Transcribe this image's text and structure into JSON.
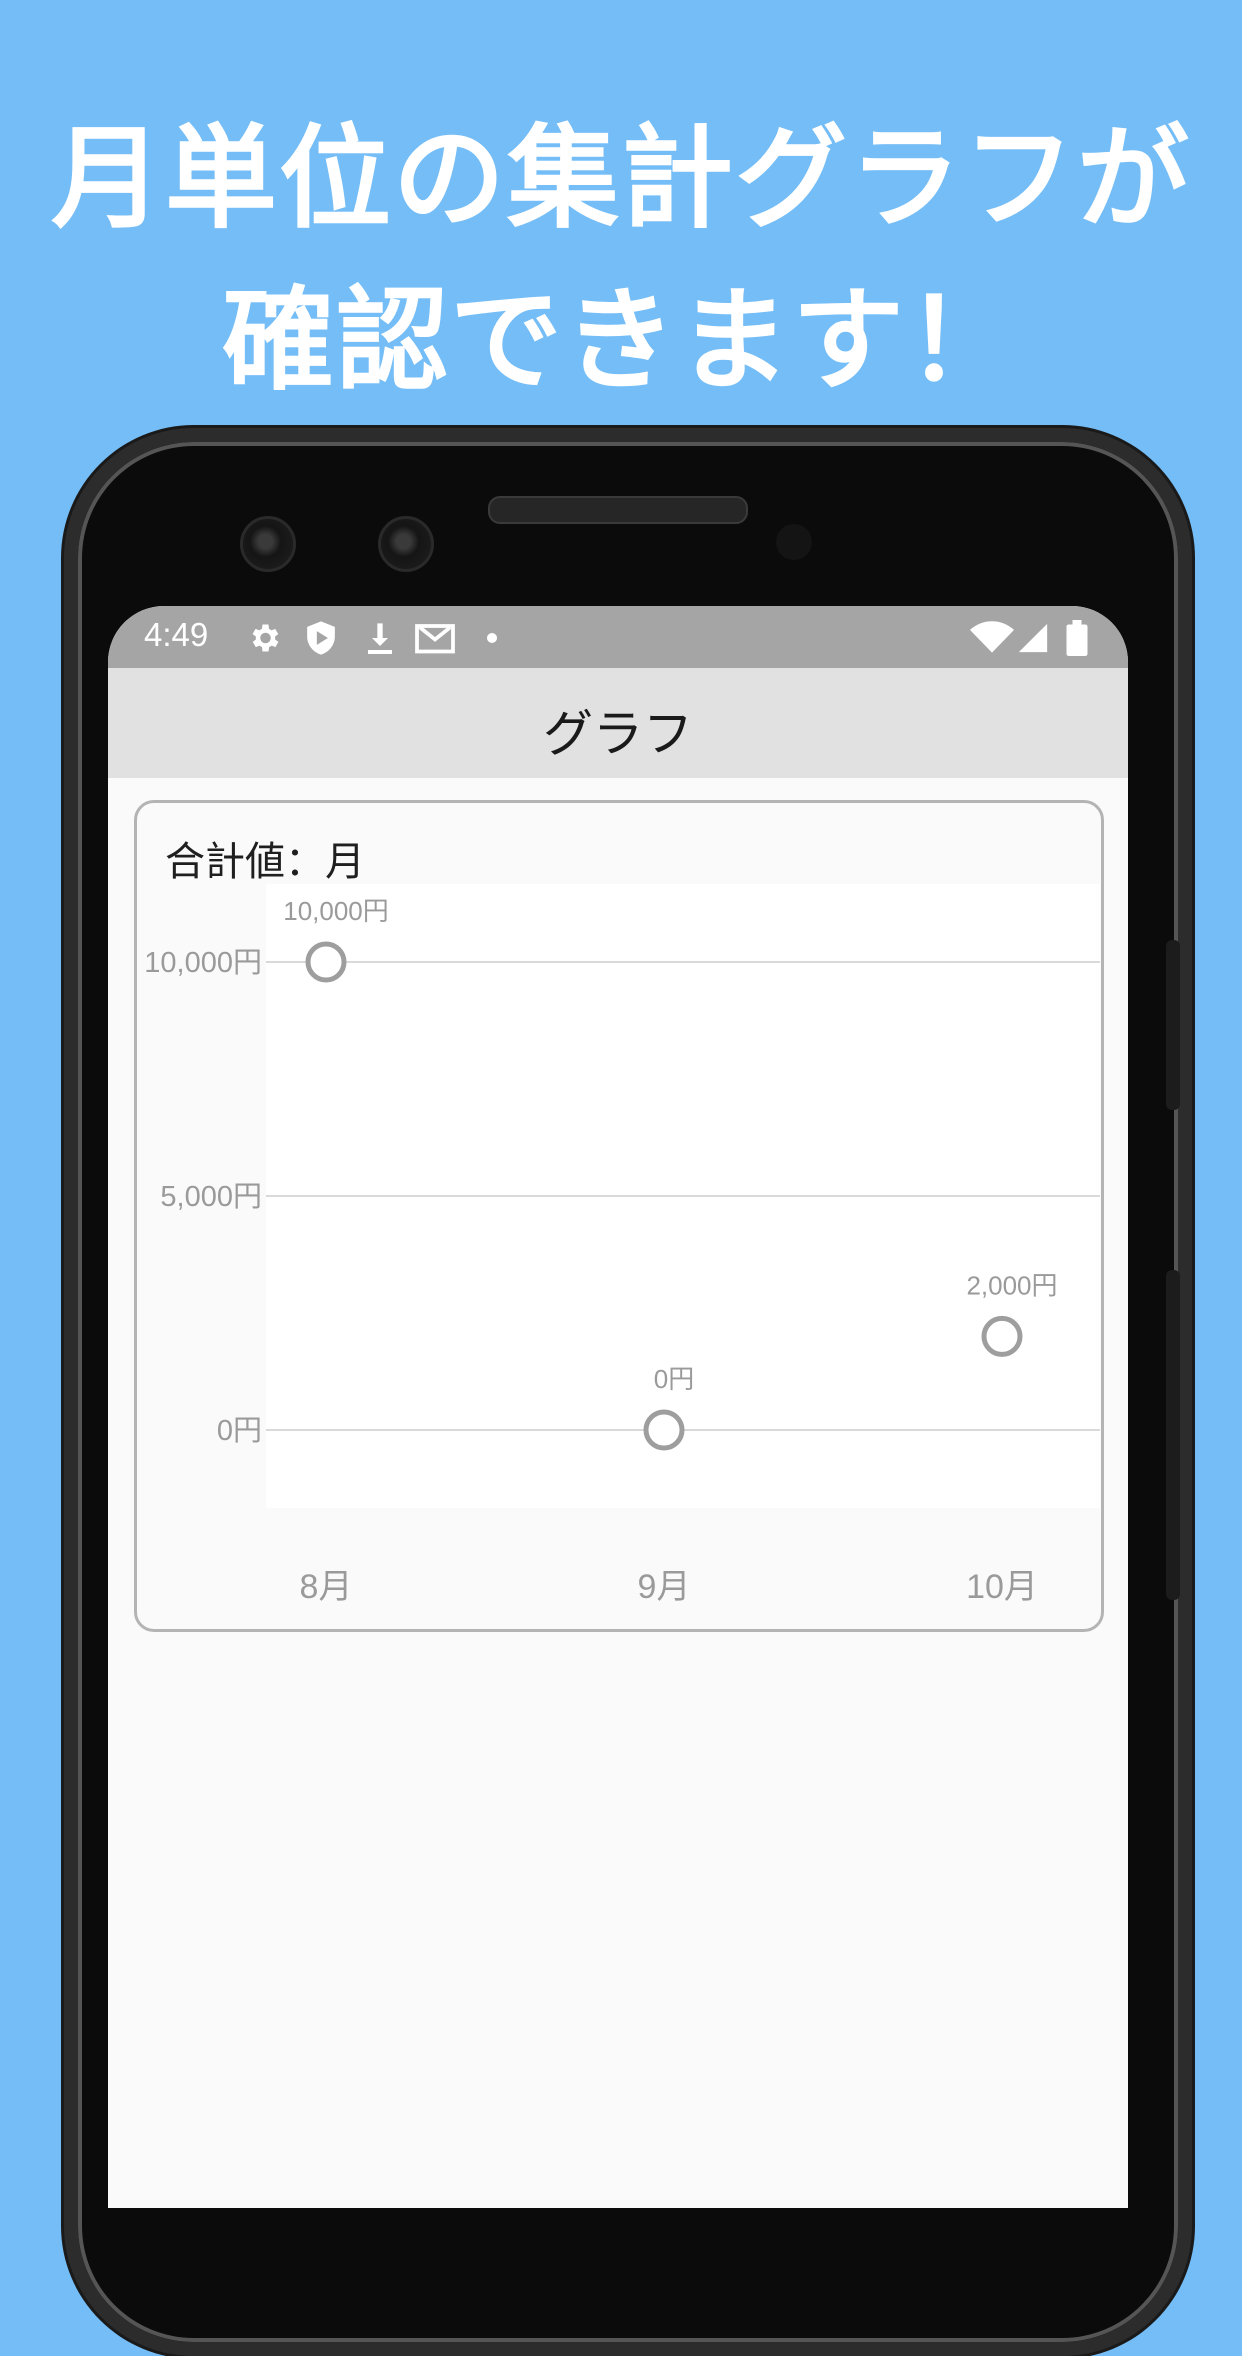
{
  "headline": {
    "line1": "月単位の集計グラフが",
    "line2": "確認できます！"
  },
  "status_bar": {
    "time": "4:49",
    "icons": [
      "settings-icon",
      "shield-play-icon",
      "download-icon",
      "gmail-icon",
      "dot-icon",
      "wifi-icon",
      "cell-signal-icon",
      "battery-icon"
    ]
  },
  "app_bar": {
    "title": "グラフ"
  },
  "card": {
    "title": "合計値：月"
  },
  "colors": {
    "background": "#74bdf7",
    "status_bar": "#a5a5a5",
    "app_bar": "#e1e1e1",
    "marker": "#9e9e9e",
    "axis_text": "#9a9a9a"
  },
  "chart_data": {
    "type": "scatter",
    "categories": [
      "8月",
      "9月",
      "10月"
    ],
    "series": [
      {
        "values": [
          10000,
          0,
          2000
        ],
        "data_labels": [
          "10,000円",
          "0円",
          "2,000円"
        ]
      }
    ],
    "y_ticks": [
      0,
      5000,
      10000
    ],
    "y_tick_labels": [
      "0円",
      "5,000円",
      "10,000円"
    ],
    "ylim": [
      0,
      10000
    ],
    "grid": true,
    "legend": "none"
  }
}
